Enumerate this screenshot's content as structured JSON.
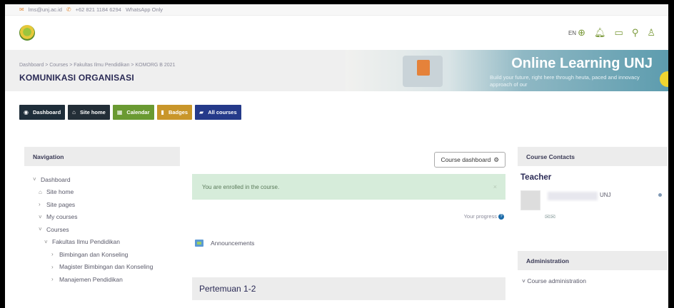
{
  "topbar": {
    "email": "lms@unj.ac.id",
    "phone": "+62 821 1184 6294",
    "note": "WhatsApp Only"
  },
  "header": {
    "lang": "EN",
    "icons": [
      "globe-icon",
      "bell-icon",
      "chat-icon",
      "search-icon",
      "user-icon"
    ]
  },
  "hero": {
    "breadcrumb": "Dashboard > Courses > Fakultas Ilmu Pendidikan > KOMORG B 2021",
    "course_title": "KOMUNIKASI ORGANISASI",
    "banner_title": "Online Learning UNJ",
    "banner_subtitle": "Build your future, right here through heuta, paced and innovacy approach of our"
  },
  "navbuttons": [
    {
      "label": "Dashboard",
      "icon": "dashboard-icon"
    },
    {
      "label": "Site home",
      "icon": "home-icon"
    },
    {
      "label": "Calendar",
      "icon": "calendar-icon"
    },
    {
      "label": "Badges",
      "icon": "bookmark-icon"
    },
    {
      "label": "All courses",
      "icon": "book-icon"
    }
  ],
  "navigation": {
    "title": "Navigation",
    "items": [
      {
        "label": "Dashboard",
        "chev": "˅"
      },
      {
        "label": "Site home",
        "chev": "⌂"
      },
      {
        "label": "Site pages",
        "chev": "›"
      },
      {
        "label": "My courses",
        "chev": "˅"
      },
      {
        "label": "Courses",
        "chev": "˅"
      },
      {
        "label": "Fakultas Ilmu Pendidikan",
        "chev": "˅"
      },
      {
        "label": "Bimbingan dan Konseling",
        "chev": "›"
      },
      {
        "label": "Magister Bimbingan dan Konseling",
        "chev": "›"
      },
      {
        "label": "Manajemen Pendidikan",
        "chev": "›"
      }
    ]
  },
  "main": {
    "course_dashboard_btn": "Course dashboard",
    "alert": "You are enrolled in the course.",
    "alert_close": "×",
    "progress_label": "Your progress",
    "announcements": "Announcements",
    "section_title": "Pertemuan 1-2"
  },
  "sidebar_right": {
    "contacts_title": "Course Contacts",
    "teacher_label": "Teacher",
    "teacher_institution": "UNJ",
    "admin_title": "Administration",
    "admin_item": "Course administration"
  },
  "colors": {
    "dashboard_btn": "#1f2e3a",
    "calendar_btn": "#6a9a32",
    "badges_btn": "#c9962a",
    "allcourses_btn": "#253a8a",
    "alert_bg": "#d6ecda"
  }
}
